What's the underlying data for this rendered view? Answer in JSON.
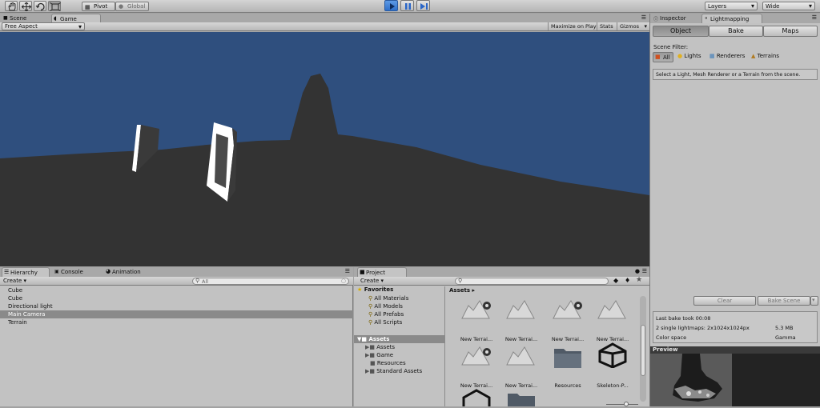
{
  "toolbar": {
    "pivot": "Pivot",
    "global": "Global",
    "layers": "Layers",
    "layout": "Wide"
  },
  "scene_tabs": {
    "scene": "Scene",
    "game": "Game"
  },
  "game_bar": {
    "aspect": "Free Aspect",
    "maximize": "Maximize on Play",
    "stats": "Stats",
    "gizmos": "Gizmos"
  },
  "colors": {
    "sky": "#2f4f7e",
    "ground": "#333333",
    "play_blue": "#3d7fd6"
  },
  "inspector_tabs": {
    "inspector": "Inspector",
    "lightmapping": "Lightmapping"
  },
  "lightmapping": {
    "modes": [
      "Object",
      "Bake",
      "Maps"
    ],
    "scene_filter_label": "Scene Filter:",
    "filters": [
      "All",
      "Lights",
      "Renderers",
      "Terrains"
    ],
    "hint": "Select a Light, Mesh Renderer or a Terrain from the scene.",
    "clear": "Clear",
    "bake_scene": "Bake Scene",
    "last_bake": "Last bake took 00:08",
    "lightmaps_label": "2 single lightmaps: 2x1024x1024px",
    "lightmaps_size": "5.3 MB",
    "color_space_label": "Color space",
    "color_space_value": "Gamma",
    "preview": "Preview"
  },
  "hierarchy": {
    "tabs": [
      "Hierarchy",
      "Console",
      "Animation"
    ],
    "create": "Create",
    "search_placeholder": "All",
    "items": [
      "Cube",
      "Cube",
      "Directional light",
      "Main Camera",
      "Terrain"
    ],
    "selected_index": 3
  },
  "project": {
    "tab": "Project",
    "create": "Create",
    "favorites_label": "Favorites",
    "favorites": [
      "All Materials",
      "All Models",
      "All Prefabs",
      "All Scripts"
    ],
    "assets_root": "Assets",
    "tree": [
      "Assets",
      "Game",
      "Resources",
      "Standard Assets"
    ],
    "breadcrumb": "Assets",
    "grid": [
      "New Terrai...",
      "New Terrai...",
      "New Terrai...",
      "New Terrai...",
      "New Terrai...",
      "New Terrai...",
      "Resources",
      "Skeleton-P..."
    ]
  }
}
